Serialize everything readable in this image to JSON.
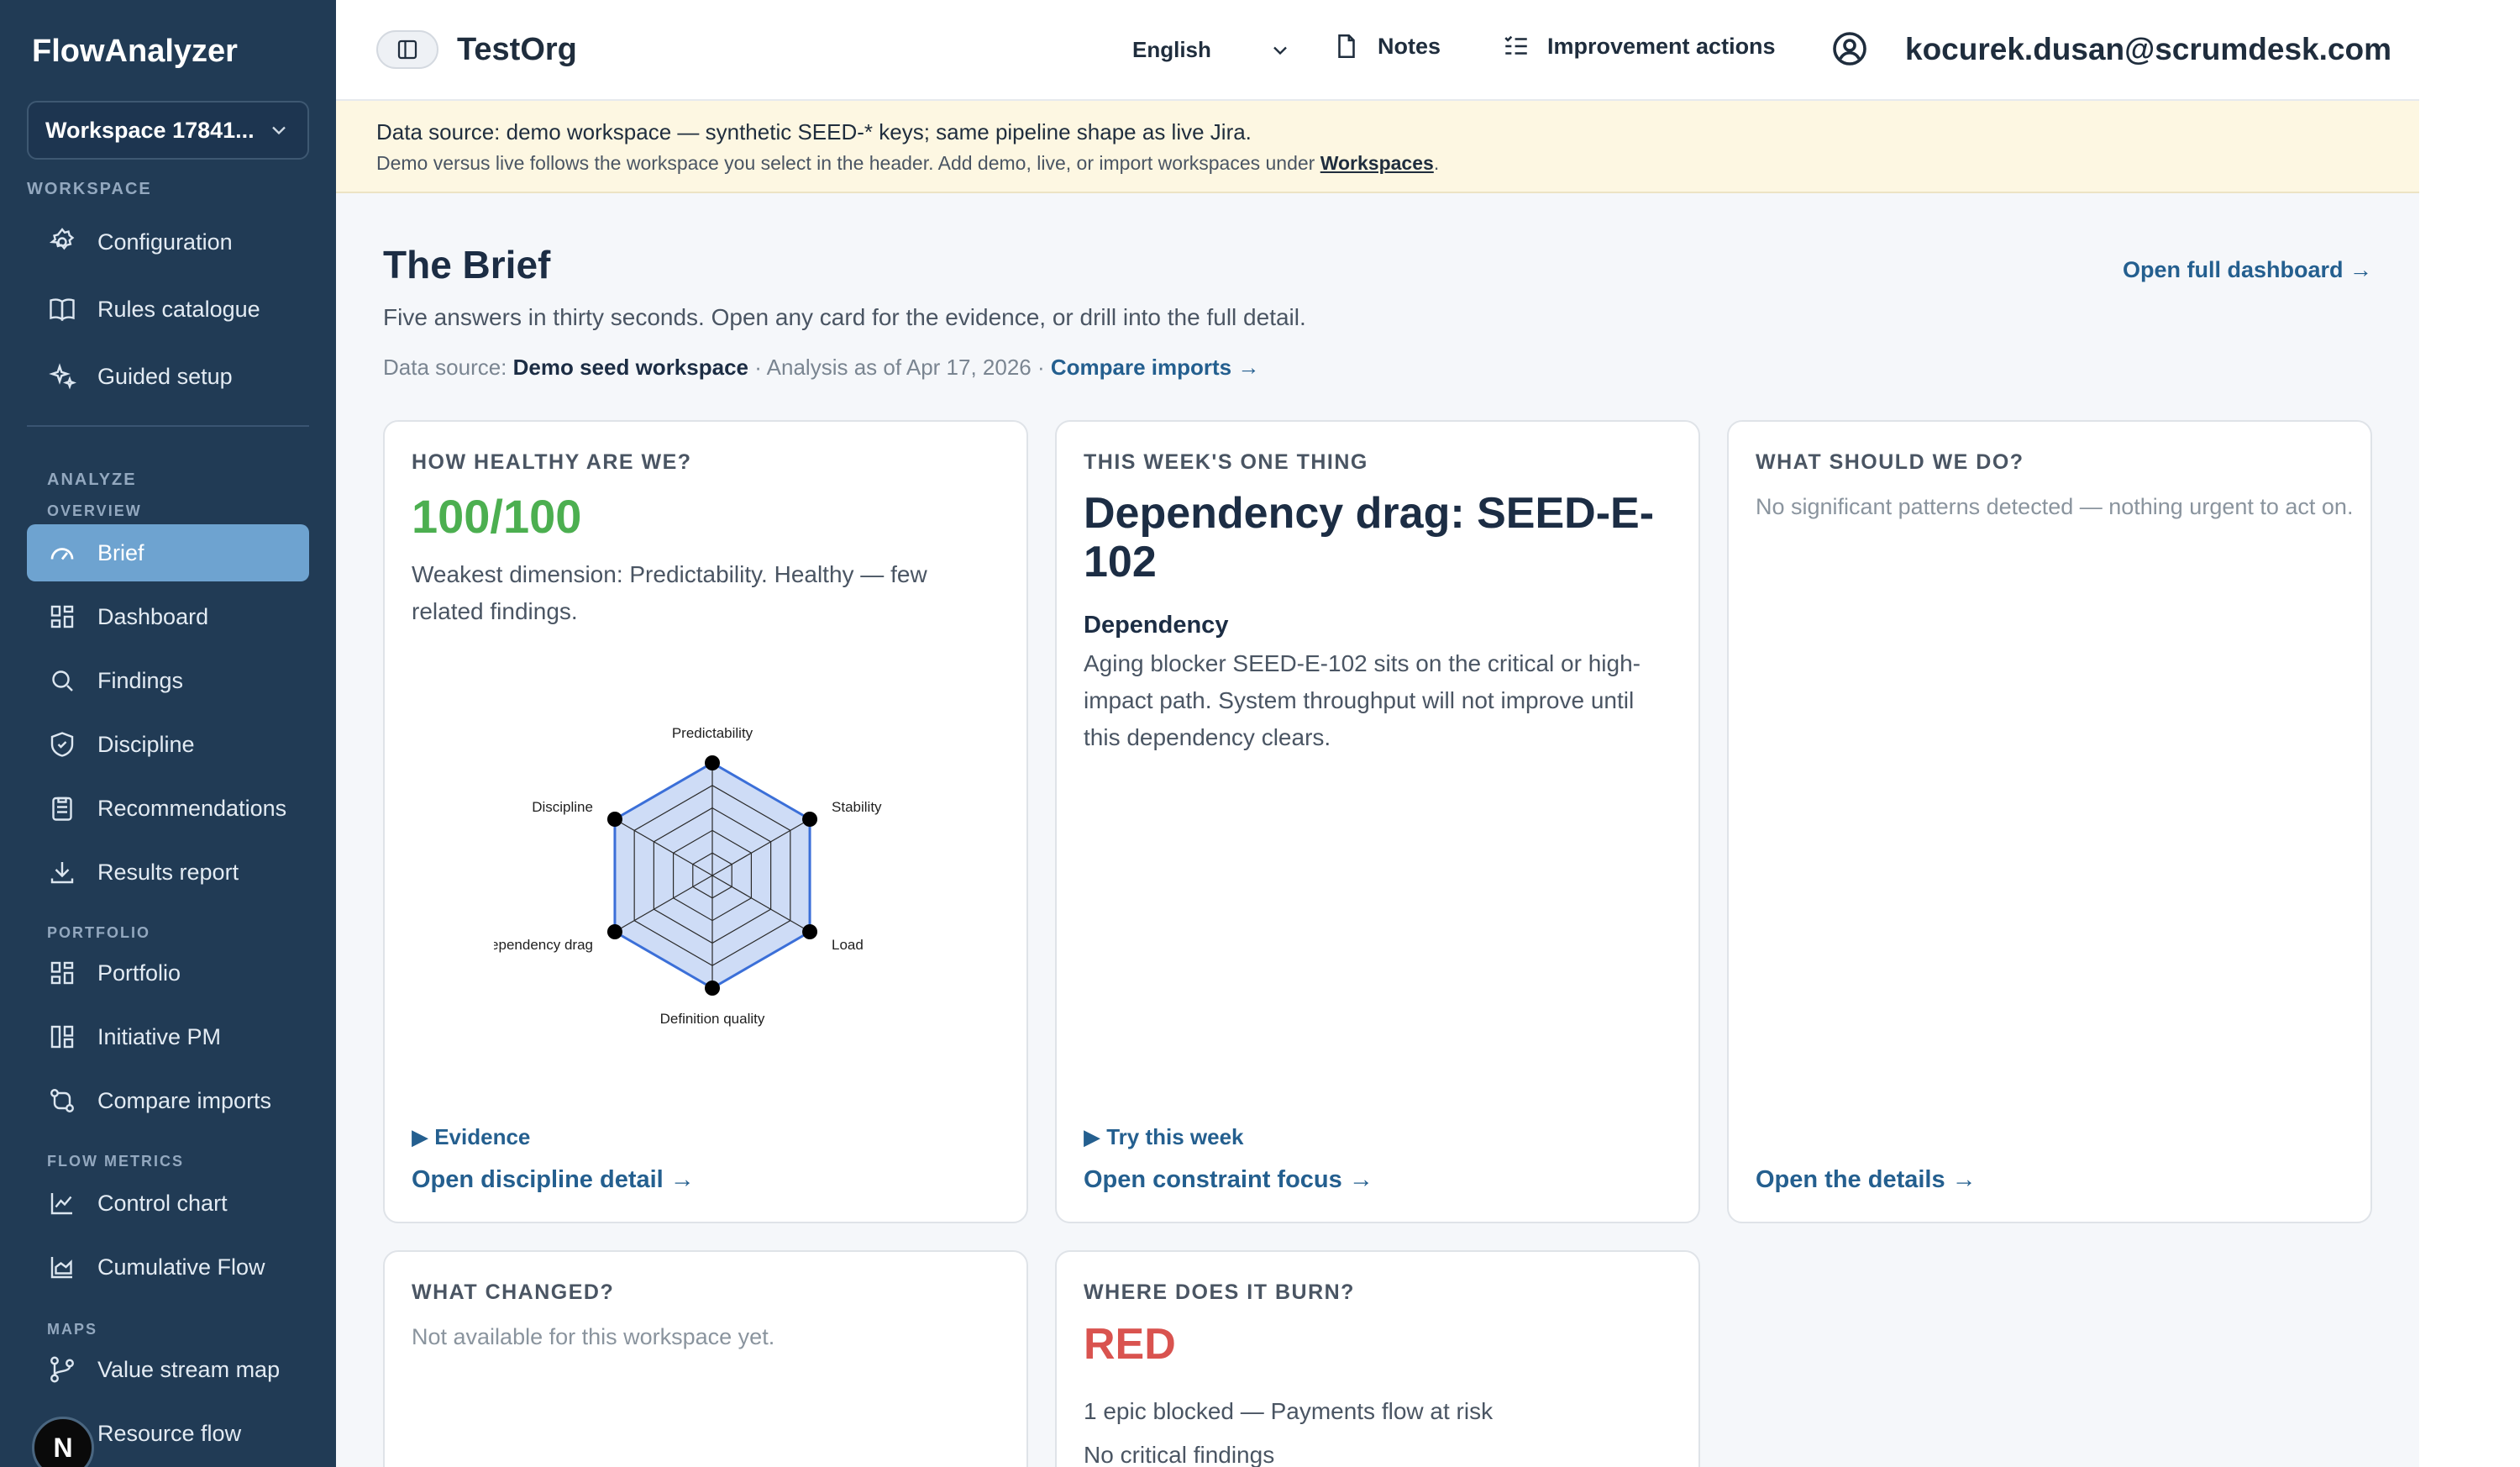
{
  "sidebar": {
    "app_title": "FlowAnalyzer",
    "workspace_select": "Workspace 17841...",
    "sections": {
      "workspace": "WORKSPACE",
      "analyze": "ANALYZE",
      "overview": "OVERVIEW",
      "portfolio": "PORTFOLIO",
      "flow_metrics": "FLOW METRICS",
      "maps": "MAPS"
    },
    "items": {
      "configuration": "Configuration",
      "rules": "Rules catalogue",
      "guided": "Guided setup",
      "brief": "Brief",
      "dashboard": "Dashboard",
      "findings": "Findings",
      "discipline": "Discipline",
      "recommendations": "Recommendations",
      "results": "Results report",
      "portfolio": "Portfolio",
      "initiative": "Initiative PM",
      "compare": "Compare imports",
      "control": "Control chart",
      "cumulative": "Cumulative Flow",
      "value_stream": "Value stream map",
      "resource_flow": "Resource flow"
    },
    "badge": "N"
  },
  "header": {
    "org": "TestOrg",
    "language": "English",
    "notes": "Notes",
    "improvement": "Improvement actions",
    "email": "kocurek.dusan@scrumdesk.com"
  },
  "banner": {
    "line1": "Data source: demo workspace — synthetic SEED-* keys; same pipeline shape as live Jira.",
    "line2_prefix": "Demo versus live follows the workspace you select in the header. Add demo, live, or import workspaces under ",
    "line2_link": "Workspaces",
    "line2_suffix": "."
  },
  "main": {
    "title": "The Brief",
    "open_dashboard": "Open full dashboard →",
    "subtitle": "Five answers in thirty seconds. Open any card for the evidence, or drill into the full detail.",
    "meta_prefix": "Data source: ",
    "meta_source": "Demo seed workspace",
    "meta_analysis": " · Analysis as of Apr 17, 2026 · ",
    "meta_link": "Compare imports →"
  },
  "cards": {
    "health": {
      "label": "HOW HEALTHY ARE WE?",
      "score": "100/100",
      "text": "Weakest dimension: Predictability. Healthy — few related findings.",
      "evidence": "▶ Evidence",
      "link": "Open discipline detail →"
    },
    "one_thing": {
      "label": "THIS WEEK'S ONE THING",
      "title": "Dependency drag: SEED-E-102",
      "subtitle": "Dependency",
      "text": "Aging blocker SEED-E-102 sits on the critical or high-impact path. System throughput will not improve until this dependency clears.",
      "try": "▶ Try this week",
      "link": "Open constraint focus →"
    },
    "what_do": {
      "label": "WHAT SHOULD WE DO?",
      "text": "No significant patterns detected — nothing urgent to act on.",
      "link": "Open the details →"
    },
    "changed": {
      "label": "WHAT CHANGED?",
      "text": "Not available for this workspace yet."
    },
    "burn": {
      "label": "WHERE DOES IT BURN?",
      "status": "RED",
      "line1": "1 epic blocked — Payments flow at risk",
      "line2": "No critical findings"
    }
  },
  "chart_data": {
    "type": "radar",
    "axes": [
      "Predictability",
      "Stability",
      "Load",
      "Definition quality",
      "Dependency drag",
      "Discipline"
    ],
    "values": [
      100,
      100,
      100,
      100,
      100,
      100
    ],
    "range": [
      0,
      100
    ],
    "colors": {
      "fill": "#c9d8f5",
      "stroke": "#3b6fd8",
      "grid": "#2a2a2a",
      "point": "#000000"
    }
  }
}
